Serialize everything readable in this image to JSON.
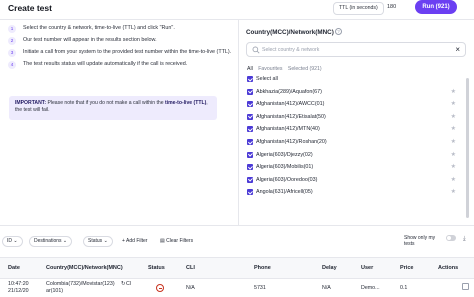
{
  "header": {
    "title": "Create test",
    "ttl_label": "TTL (in seconds)",
    "ttl_value": "180",
    "run_label": "Run (921)"
  },
  "steps": [
    {
      "num": "1",
      "text": "Select the country & network, time-to-live (TTL) and click \"Run\"."
    },
    {
      "num": "2",
      "text": "Our test number will appear in the results section below."
    },
    {
      "num": "3",
      "text": "Initiate a call from your system to the provided test number within the time-to-live (TTL)."
    },
    {
      "num": "4",
      "text": "The test results status will update automatically if the call is received."
    }
  ],
  "important": {
    "label": "IMPORTANT:",
    "text_a": " Please note that if you do not make a call within the ",
    "ttl": "time-to-live (TTL)",
    "text_b": ", the test will fail."
  },
  "country_panel": {
    "title": "Country(MCC)/Network(MNC)",
    "search_placeholder": "Select country & network",
    "tabs": [
      "All",
      "Favourites",
      "Selected (921)"
    ],
    "items": [
      "Select all",
      "Abkhazia(289)/Aquafon(67)",
      "Afghanistan(412)/AWCC(01)",
      "Afghanistan(412)/Etisalat(50)",
      "Afghanistan(412)/MTN(40)",
      "Afghanistan(412)/Roshan(20)",
      "Algeria(603)/Djezzy(02)",
      "Algeria(603)/Mobilis(01)",
      "Algeria(603)/Ooredoo(03)",
      "Angola(631)/Africell(05)"
    ]
  },
  "toolbar": {
    "id_label": "ID",
    "destinations_label": "Destinations",
    "status_label": "Status",
    "add_filter": "+ Add Filter",
    "clear_filters": "Clear Filters",
    "show_only_mine": "Show only my tests"
  },
  "table": {
    "headers": [
      "Date",
      "Country(MCC)/Network(MNC)",
      "Status",
      "CLI",
      "Phone",
      "Delay",
      "User",
      "Price",
      "Actions"
    ],
    "row": {
      "date_line1": "10:47:20",
      "date_line2": "21/12/20",
      "country_line1": "Colombia(732)/Movistar(123)",
      "country_line2": "ar(101)",
      "cli": "N/A",
      "phone": "5731",
      "delay": "N/A",
      "user": "Demo...",
      "price": "0.1"
    }
  },
  "colors": {
    "accent": "#6b3ff2",
    "checkbox": "#4b3ad6",
    "error": "#c8331f"
  }
}
